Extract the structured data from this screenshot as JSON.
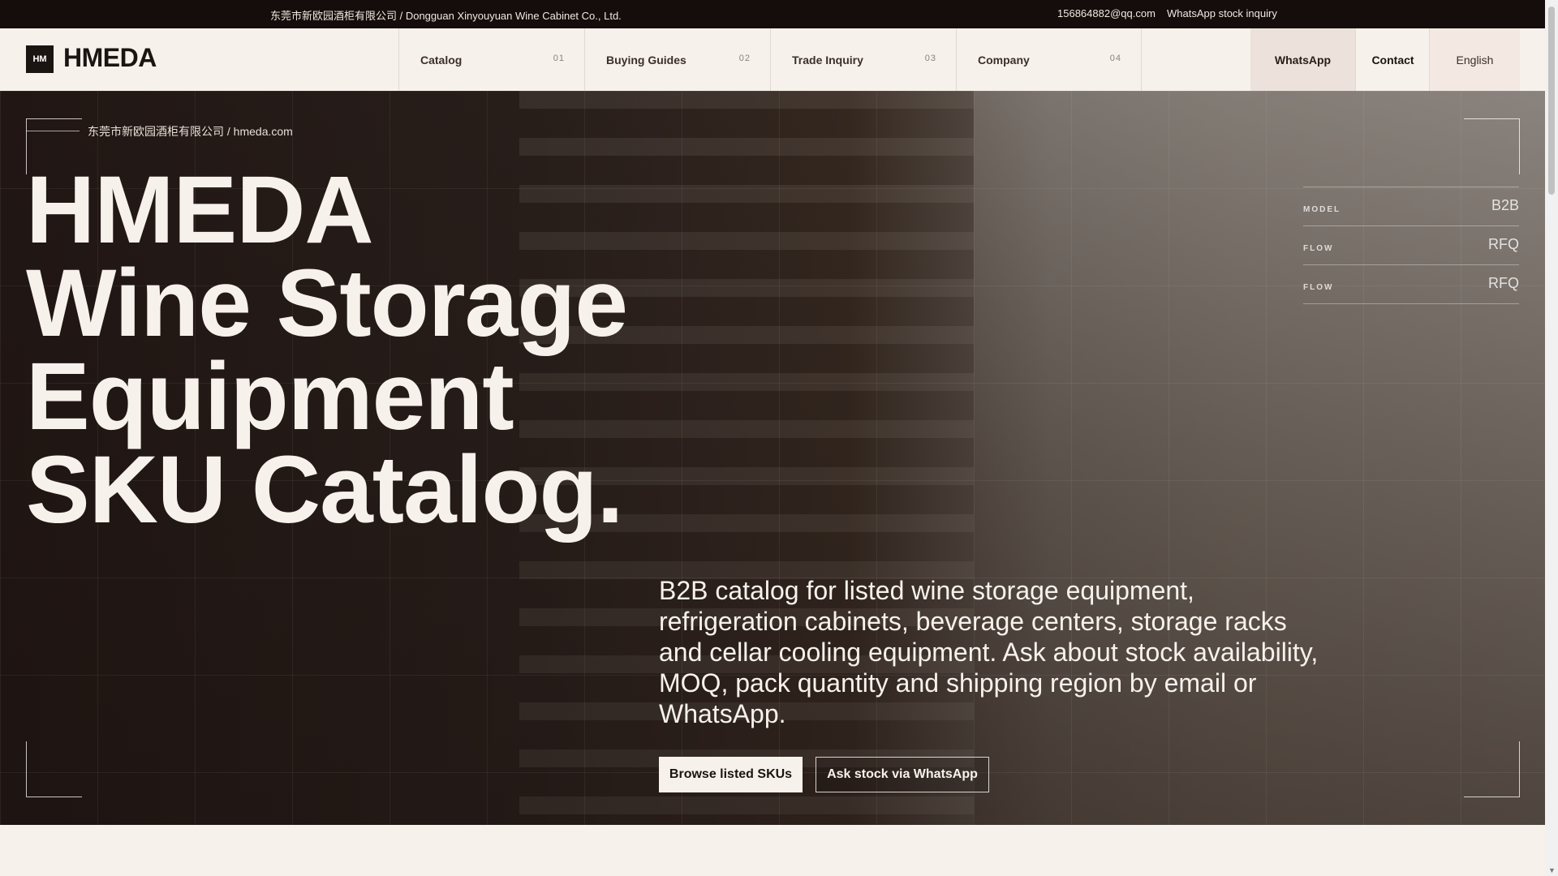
{
  "topbar": {
    "company": "东莞市新欧园酒柜有限公司 / Dongguan Xinyouyuan Wine Cabinet Co., Ltd.",
    "email": "156864882@qq.com",
    "whatsapp_inquiry": "WhatsApp stock inquiry"
  },
  "header": {
    "logo_mark": "HM",
    "logo_text": "HMEDA",
    "nav": [
      {
        "label": "Catalog",
        "num": "01"
      },
      {
        "label": "Buying Guides",
        "num": "02"
      },
      {
        "label": "Trade Inquiry",
        "num": "03"
      },
      {
        "label": "Company",
        "num": "04"
      }
    ],
    "whatsapp": "WhatsApp",
    "contact": "Contact",
    "language": "English"
  },
  "hero": {
    "eyebrow": "东莞市新欧园酒柜有限公司 / hmeda.com",
    "title_lines": [
      "HMEDA",
      "Wine Storage",
      "Equipment",
      "SKU Catalog."
    ],
    "specs": [
      {
        "key": "MODEL",
        "value": "B2B"
      },
      {
        "key": "FLOW",
        "value": "RFQ"
      },
      {
        "key": "FLOW",
        "value": "RFQ"
      }
    ],
    "description": "B2B catalog for listed wine storage equipment, refrigeration cabinets, beverage centers, storage racks and cellar cooling equipment. Ask about stock availability, MOQ, pack quantity and shipping region by email or WhatsApp.",
    "primary_cta": "Browse listed SKUs",
    "secondary_cta": "Ask stock via WhatsApp"
  }
}
